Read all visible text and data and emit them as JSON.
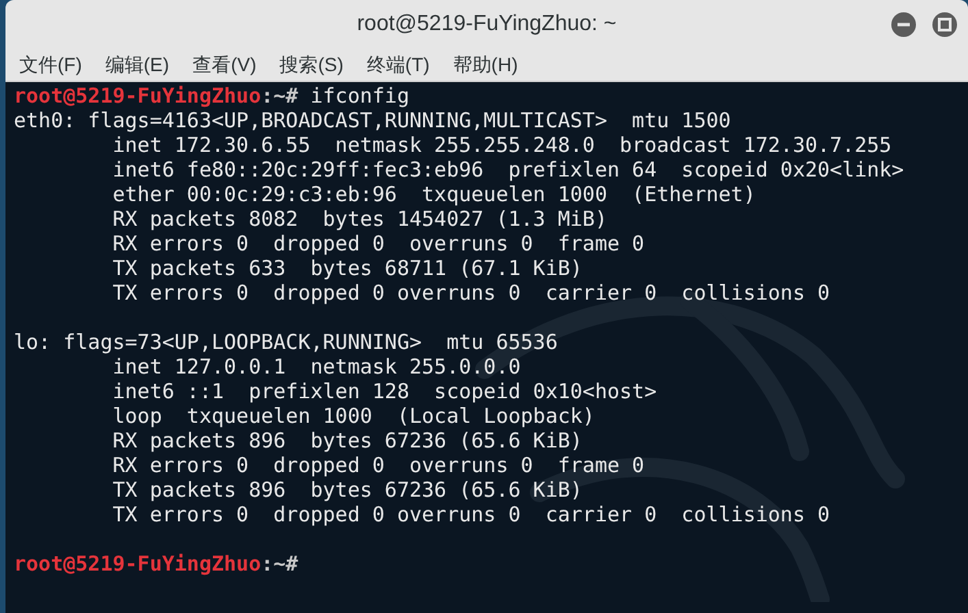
{
  "window": {
    "title": "root@5219-FuYingZhuo: ~"
  },
  "menu": [
    "文件(F)",
    "编辑(E)",
    "查看(V)",
    "搜索(S)",
    "终端(T)",
    "帮助(H)"
  ],
  "terminal": {
    "lines": [
      {
        "kind": "prompt",
        "user_host": "root@5219-FuYingZhuo",
        "path": ":~#",
        "command": "ifconfig"
      },
      {
        "kind": "output",
        "text": "eth0: flags=4163<UP,BROADCAST,RUNNING,MULTICAST>  mtu 1500"
      },
      {
        "kind": "output",
        "text": "        inet 172.30.6.55  netmask 255.255.248.0  broadcast 172.30.7.255"
      },
      {
        "kind": "output",
        "text": "        inet6 fe80::20c:29ff:fec3:eb96  prefixlen 64  scopeid 0x20<link>"
      },
      {
        "kind": "output",
        "text": "        ether 00:0c:29:c3:eb:96  txqueuelen 1000  (Ethernet)"
      },
      {
        "kind": "output",
        "text": "        RX packets 8082  bytes 1454027 (1.3 MiB)"
      },
      {
        "kind": "output",
        "text": "        RX errors 0  dropped 0  overruns 0  frame 0"
      },
      {
        "kind": "output",
        "text": "        TX packets 633  bytes 68711 (67.1 KiB)"
      },
      {
        "kind": "output",
        "text": "        TX errors 0  dropped 0 overruns 0  carrier 0  collisions 0"
      },
      {
        "kind": "blank"
      },
      {
        "kind": "output",
        "text": "lo: flags=73<UP,LOOPBACK,RUNNING>  mtu 65536"
      },
      {
        "kind": "output",
        "text": "        inet 127.0.0.1  netmask 255.0.0.0"
      },
      {
        "kind": "output",
        "text": "        inet6 ::1  prefixlen 128  scopeid 0x10<host>"
      },
      {
        "kind": "output",
        "text": "        loop  txqueuelen 1000  (Local Loopback)"
      },
      {
        "kind": "output",
        "text": "        RX packets 896  bytes 67236 (65.6 KiB)"
      },
      {
        "kind": "output",
        "text": "        RX errors 0  dropped 0  overruns 0  frame 0"
      },
      {
        "kind": "output",
        "text": "        TX packets 896  bytes 67236 (65.6 KiB)"
      },
      {
        "kind": "output",
        "text": "        TX errors 0  dropped 0 overruns 0  carrier 0  collisions 0"
      },
      {
        "kind": "blank"
      },
      {
        "kind": "prompt",
        "user_host": "root@5219-FuYingZhuo",
        "path": ":~#"
      }
    ]
  }
}
